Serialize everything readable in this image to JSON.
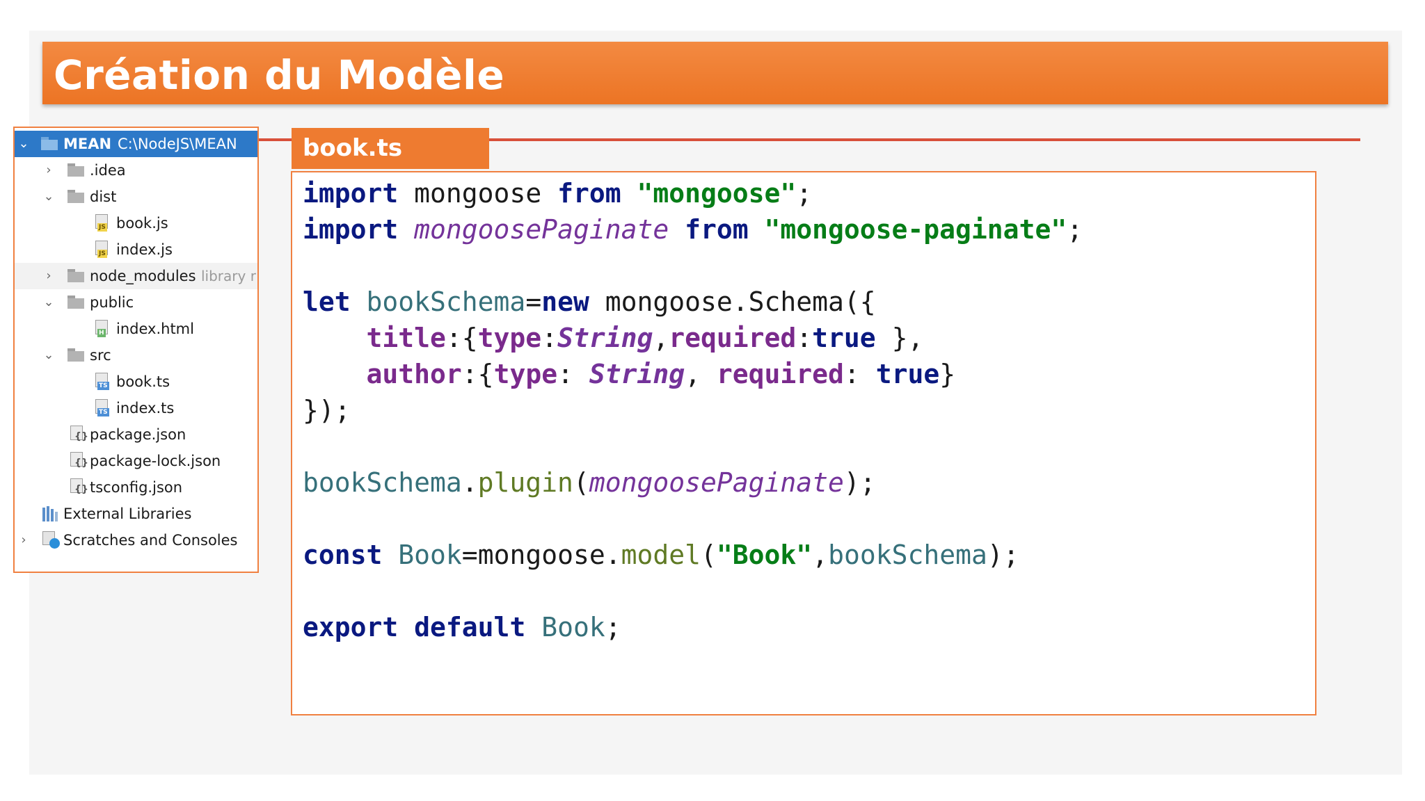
{
  "slide": {
    "title": "Création du Modèle"
  },
  "project_tree": {
    "root": {
      "name": "MEAN",
      "path": "C:\\NodeJS\\MEAN"
    },
    "items": [
      {
        "label": ".idea",
        "kind": "folder",
        "expanded": false
      },
      {
        "label": "dist",
        "kind": "folder",
        "expanded": true
      },
      {
        "label": "book.js",
        "kind": "file",
        "badge": "JS"
      },
      {
        "label": "index.js",
        "kind": "file",
        "badge": "JS"
      },
      {
        "label": "node_modules",
        "kind": "folder",
        "expanded": false,
        "suffix": "library r"
      },
      {
        "label": "public",
        "kind": "folder",
        "expanded": true
      },
      {
        "label": "index.html",
        "kind": "file",
        "badge": "H"
      },
      {
        "label": "src",
        "kind": "folder",
        "expanded": true
      },
      {
        "label": "book.ts",
        "kind": "file",
        "badge": "TS"
      },
      {
        "label": "index.ts",
        "kind": "file",
        "badge": "TS"
      },
      {
        "label": "package.json",
        "kind": "json"
      },
      {
        "label": "package-lock.json",
        "kind": "json"
      },
      {
        "label": "tsconfig.json",
        "kind": "json"
      },
      {
        "label": "External Libraries",
        "kind": "libraries"
      },
      {
        "label": "Scratches and Consoles",
        "kind": "scratches"
      }
    ]
  },
  "editor": {
    "tab_label": "book.ts",
    "code": {
      "import": "import",
      "mongoose": "mongoose",
      "from": "from",
      "str_mongoose": "\"mongoose\"",
      "mongoosePaginate": "mongoosePaginate",
      "str_paginate": "\"mongoose-paginate\"",
      "semicolon": ";",
      "let": "let",
      "bookSchema": "bookSchema",
      "eq": "=",
      "new": "new",
      "schema_call": " mongoose.Schema({",
      "title": "title",
      "type": "type",
      "String": "String",
      "required": "required",
      "true": "true",
      "author": "author",
      "close_obj": "});",
      "plugin": "plugin",
      "const": "const",
      "Book": "Book",
      "model": "model",
      "str_Book": "\"Book\"",
      "export": "export",
      "default": "default"
    }
  },
  "colors": {
    "banner": "#ec7424",
    "accent_line": "#d8503a",
    "panel_border": "#f08040",
    "selection": "#2d79c8",
    "keyword": "#0a1980",
    "string": "#067d17"
  }
}
